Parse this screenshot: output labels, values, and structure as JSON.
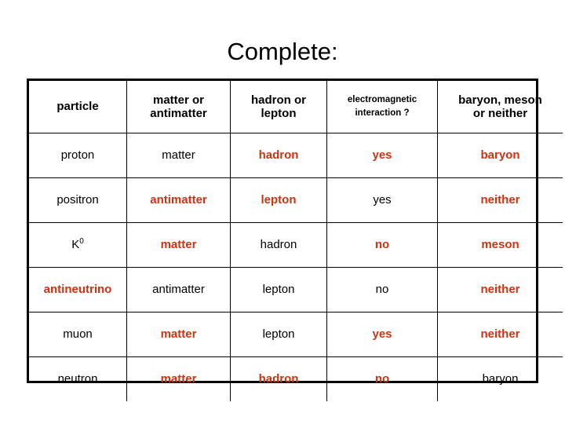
{
  "slide": {
    "title": "Complete:"
  },
  "table": {
    "headers": [
      {
        "label": "particle",
        "lines": [
          "particle"
        ],
        "style": "normal"
      },
      {
        "label": "matter or antimatter",
        "lines": [
          "matter or",
          "antimatter"
        ],
        "style": "normal"
      },
      {
        "label": "hadron or lepton",
        "lines": [
          "hadron or",
          "lepton"
        ],
        "style": "normal"
      },
      {
        "label": "electromagnetic interaction ?",
        "lines": [
          "electromagnetic",
          "interaction ?"
        ],
        "style": "small"
      },
      {
        "label": "baryon, meson or neither",
        "lines": [
          "baryon, meson",
          "or neither"
        ],
        "style": "normal"
      }
    ],
    "header_lines": {
      "h0_l0": "particle",
      "h1_l0": "matter or",
      "h1_l1": "antimatter",
      "h2_l0": "hadron or",
      "h2_l1": "lepton",
      "h3_l0": "electromagnetic",
      "h3_l1": "interaction ?",
      "h4_l0": "baryon, meson",
      "h4_l1": "or neither"
    },
    "rows": [
      {
        "particle": "proton",
        "particle_sup": "",
        "particle_color": "black",
        "matter": "matter",
        "matter_color": "black",
        "hadron": "hadron",
        "hadron_color": "red",
        "em": "yes",
        "em_color": "red",
        "class": "baryon",
        "class_color": "red"
      },
      {
        "particle": "positron",
        "particle_sup": "",
        "particle_color": "black",
        "matter": "antimatter",
        "matter_color": "red",
        "hadron": "lepton",
        "hadron_color": "red",
        "em": "yes",
        "em_color": "black",
        "class": "neither",
        "class_color": "red"
      },
      {
        "particle": "K",
        "particle_sup": "0",
        "particle_color": "black",
        "matter": "matter",
        "matter_color": "red",
        "hadron": "hadron",
        "hadron_color": "black",
        "em": "no",
        "em_color": "red",
        "class": "meson",
        "class_color": "red"
      },
      {
        "particle": "antineutrino",
        "particle_sup": "",
        "particle_color": "red",
        "matter": "antimatter",
        "matter_color": "black",
        "hadron": "lepton",
        "hadron_color": "black",
        "em": "no",
        "em_color": "black",
        "class": "neither",
        "class_color": "red"
      },
      {
        "particle": "muon",
        "particle_sup": "",
        "particle_color": "black",
        "matter": "matter",
        "matter_color": "red",
        "hadron": "lepton",
        "hadron_color": "black",
        "em": "yes",
        "em_color": "red",
        "class": "neither",
        "class_color": "red"
      },
      {
        "particle": "neutron",
        "particle_sup": "",
        "particle_color": "black",
        "matter": "matter",
        "matter_color": "red",
        "hadron": "hadron",
        "hadron_color": "red",
        "em": "no",
        "em_color": "red",
        "class": "baryon",
        "class_color": "black"
      }
    ]
  },
  "colors": {
    "answer_red": "#CC3311",
    "text_black": "#000000",
    "border": "#000000",
    "background": "#FFFFFF"
  }
}
